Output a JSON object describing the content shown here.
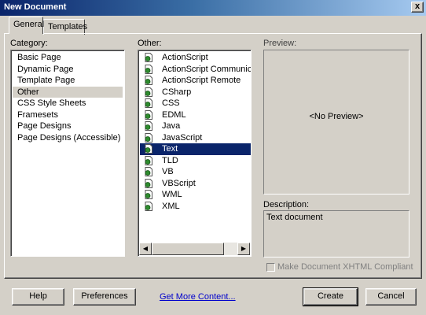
{
  "window": {
    "title": "New Document",
    "close_label": "x"
  },
  "tabs": [
    {
      "label": "General",
      "active": true
    },
    {
      "label": "Templates",
      "active": false
    }
  ],
  "category": {
    "label": "Category:",
    "items": [
      "Basic Page",
      "Dynamic Page",
      "Template Page",
      "Other",
      "CSS Style Sheets",
      "Framesets",
      "Page Designs",
      "Page Designs (Accessible)"
    ],
    "selected": "Other"
  },
  "other": {
    "label": "Other:",
    "items": [
      "ActionScript",
      "ActionScript Communicatio",
      "ActionScript Remote",
      "CSharp",
      "CSS",
      "EDML",
      "Java",
      "JavaScript",
      "Text",
      "TLD",
      "VB",
      "VBScript",
      "WML",
      "XML"
    ],
    "selected": "Text",
    "item_icon": "document-icon"
  },
  "preview": {
    "label": "Preview:",
    "text": "<No Preview>"
  },
  "description": {
    "label": "Description:",
    "text": "Text document"
  },
  "xhtml": {
    "label": "Make Document XHTML Compliant",
    "checked": false,
    "enabled": false
  },
  "buttons": {
    "help": "Help",
    "preferences": "Preferences",
    "get_more": "Get More Content...",
    "create": "Create",
    "cancel": "Cancel"
  },
  "colors": {
    "selection": "#0a246a",
    "face": "#d4d0c8",
    "link": "#0000cc"
  }
}
